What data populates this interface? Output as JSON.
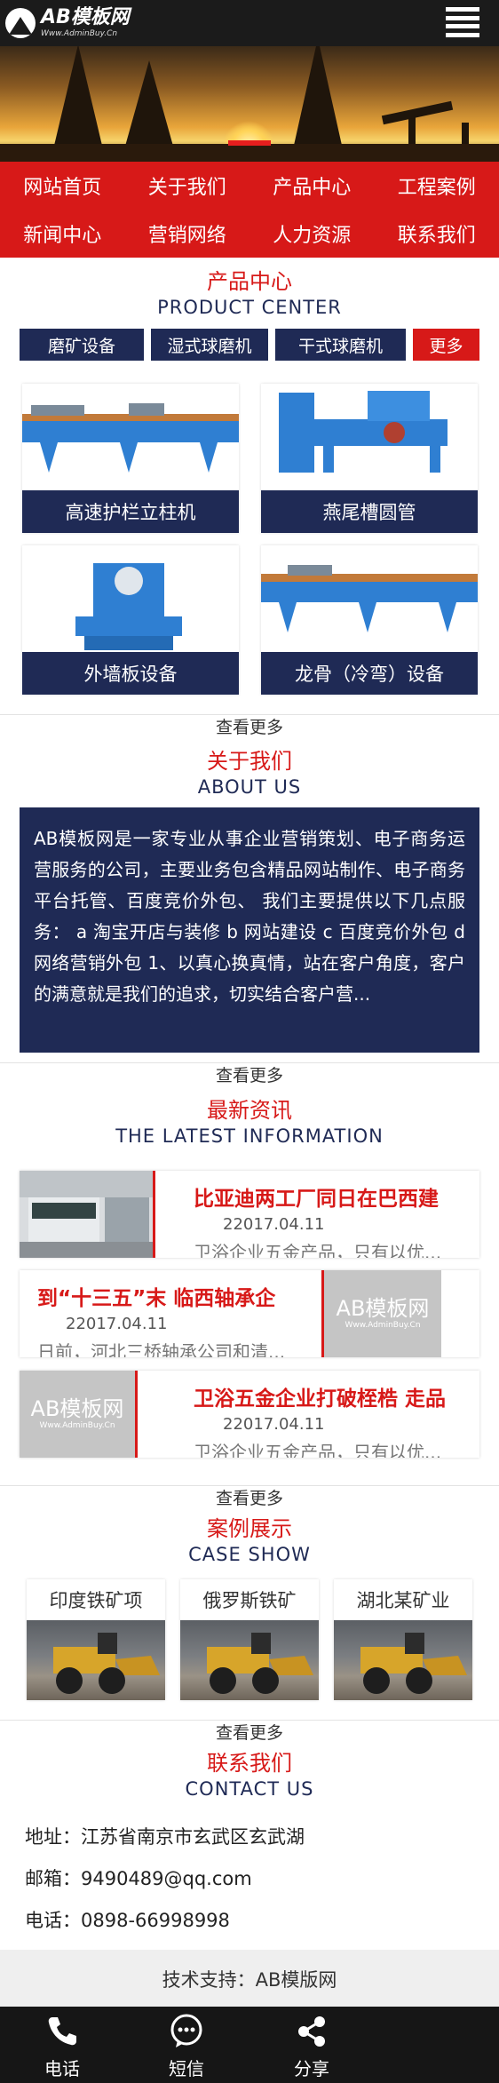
{
  "header": {
    "logo_name": "AB模板网",
    "logo_url": "Www.AdminBuy.Cn",
    "menu_icon": "hamburger-menu-icon"
  },
  "banner": {
    "active_slide": 1,
    "slide_count": 1
  },
  "nav": {
    "items": [
      "网站首页",
      "关于我们",
      "产品中心",
      "工程案例",
      "新闻中心",
      "营销网络",
      "人力资源",
      "联系我们"
    ]
  },
  "products": {
    "title_cn": "产品中心",
    "title_en": "PRODUCT CENTER",
    "tabs": [
      "磨矿设备",
      "湿式球磨机",
      "干式球磨机"
    ],
    "more_tab": "更多",
    "items": [
      "高速护栏立柱机",
      "燕尾槽圆管",
      "外墙板设备",
      "龙骨（冷弯）设备"
    ],
    "more": "查看更多"
  },
  "about": {
    "title_cn": "关于我们",
    "title_en": "ABOUT US",
    "text": "AB模板网是一家专业从事企业营销策划、电子商务运营服务的公司，主要业务包含精品网站制作、电子商务平台托管、百度竞价外包、 我们主要提供以下几点服务： a 淘宝开店与装修 b 网站建设 c 百度竞价外包 d 网络营销外包 1、以真心换真情，站在客户角度，客户的满意就是我们的追求，切实结合客户营...",
    "more": "查看更多"
  },
  "news": {
    "title_cn": "最新资讯",
    "title_en": "THE LATEST INFORMATION",
    "items": [
      {
        "title": "比亚迪两工厂同日在巴西建",
        "date": "22017.04.11",
        "summary": "卫浴企业五金产品，只有以优..."
      },
      {
        "title": "到“十三五”末 临西轴承企",
        "date": "22017.04.11",
        "summary": "日前，河北三桥轴承公司和清..."
      },
      {
        "title": "卫浴五金企业打破桎梏 走品",
        "date": "22017.04.11",
        "summary": "卫浴企业五金产品，只有以优..."
      }
    ],
    "placeholder_logo": "AB模板网",
    "placeholder_url": "Www.AdminBuy.Cn",
    "more": "查看更多"
  },
  "cases": {
    "title_cn": "案例展示",
    "title_en": "CASE SHOW",
    "items": [
      "印度铁矿项",
      "俄罗斯铁矿",
      "湖北某矿业"
    ],
    "more": "查看更多"
  },
  "contact": {
    "title_cn": "联系我们",
    "title_en": "CONTACT US",
    "address": "地址：江苏省南京市玄武区玄武湖",
    "email": "邮箱：9490489@qq.com",
    "phone": "电话：0898-66998998"
  },
  "footer": {
    "support": "技术支持：AB模版网"
  },
  "bottom_bar": {
    "items": [
      {
        "label": "电话",
        "icon": "phone-icon"
      },
      {
        "label": "短信",
        "icon": "message-icon"
      },
      {
        "label": "分享",
        "icon": "share-icon"
      }
    ]
  },
  "colors": {
    "primary_red": "#d71918",
    "navy": "#1f2a55",
    "dark_bar": "#161616"
  }
}
